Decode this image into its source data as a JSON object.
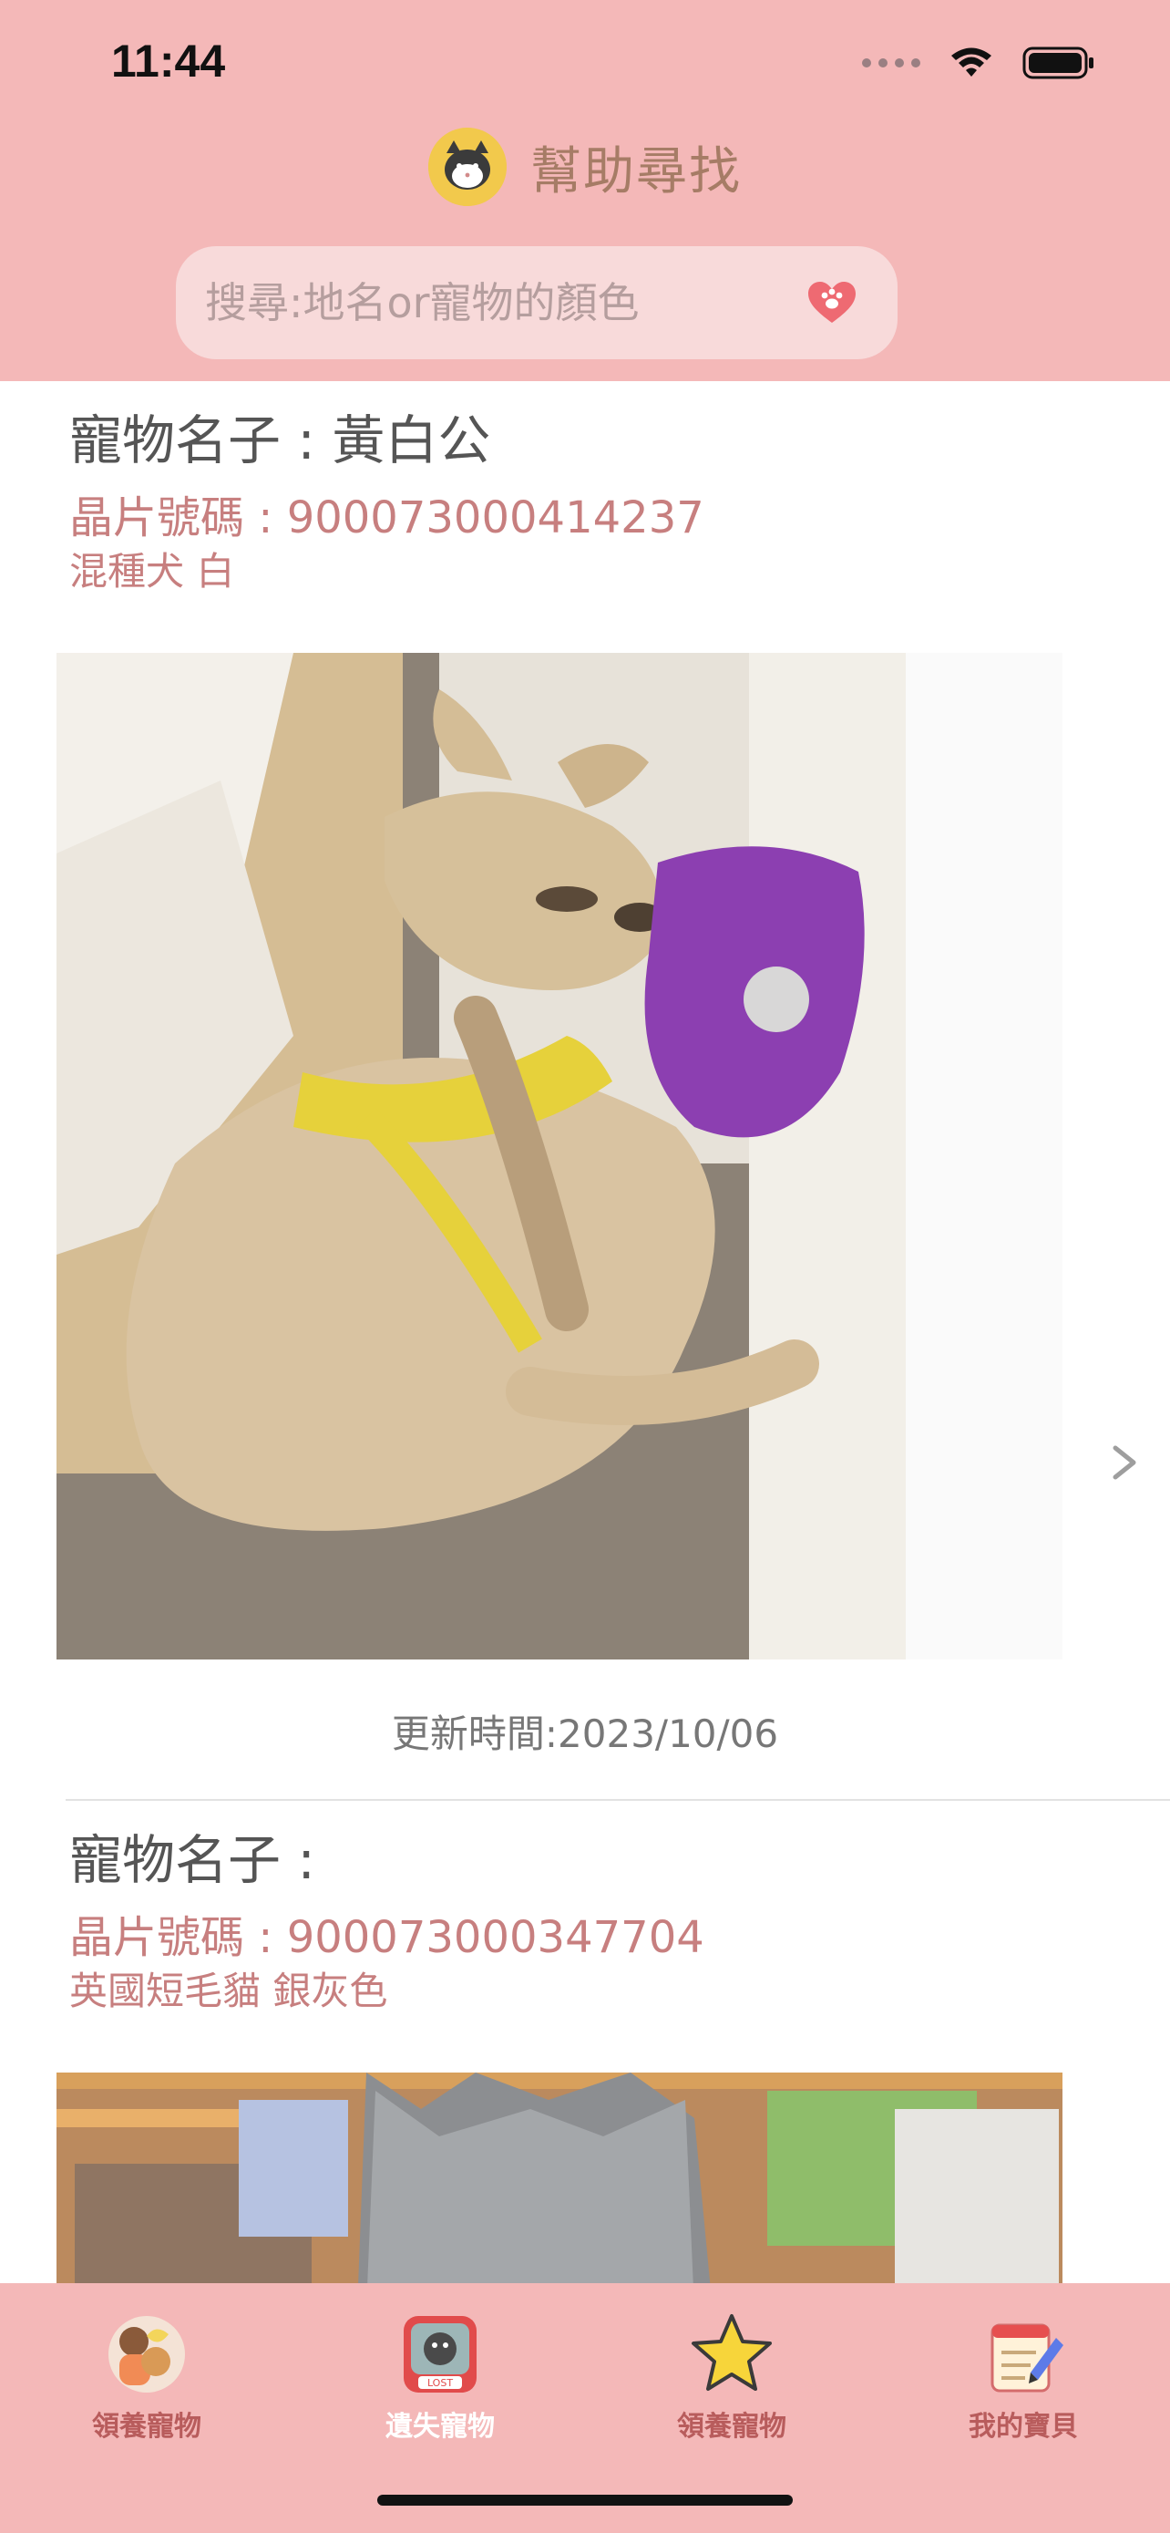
{
  "status_bar": {
    "time": "11:44"
  },
  "header": {
    "title": "幫助尋找"
  },
  "search": {
    "placeholder": "搜尋:地名or寵物的顏色"
  },
  "cards": [
    {
      "name_line": "寵物名子 : 黃白公",
      "chip_line": "晶片號碼 : 900073000414237",
      "meta_line": "混種犬  白",
      "updated_line": "更新時間:2023/10/06"
    },
    {
      "name_line": "寵物名子 : ",
      "chip_line": "晶片號碼 : 900073000347704",
      "meta_line": "英國短毛貓  銀灰色"
    }
  ],
  "tabs": [
    {
      "label": "領養寵物",
      "icon": "adopt-icon",
      "active": false
    },
    {
      "label": "遺失寵物",
      "icon": "lost-pet-icon",
      "active": true
    },
    {
      "label": "領養寵物",
      "icon": "star-icon",
      "active": false
    },
    {
      "label": "我的寶貝",
      "icon": "notebook-icon",
      "active": false
    }
  ],
  "colors": {
    "header_bg": "#F4B8B8",
    "accent_text": "#C77F7F",
    "tab_inactive": "#B85C5C",
    "tab_active": "#FFFFFF"
  }
}
